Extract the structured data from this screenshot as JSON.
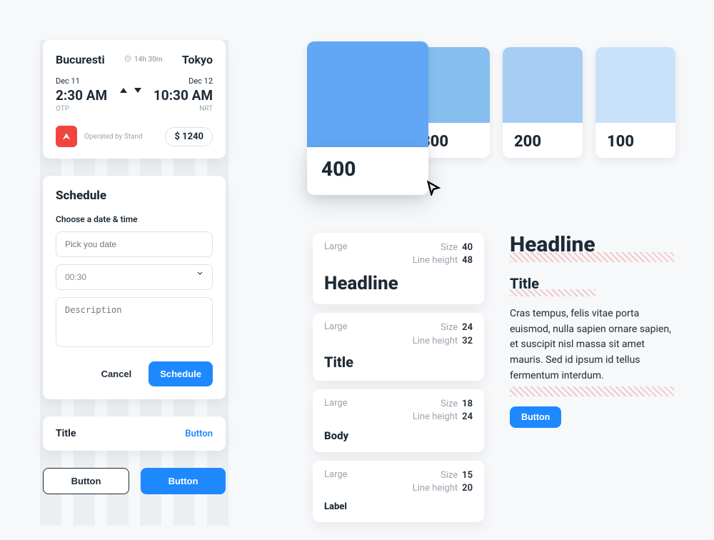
{
  "flight": {
    "from_city": "Bucuresti",
    "to_city": "Tokyo",
    "duration": "14h 30m",
    "dep_date": "Dec 11",
    "dep_time": "2:30 AM",
    "dep_code": "OTP",
    "arr_date": "Dec 12",
    "arr_time": "10:30 AM",
    "arr_code": "NRT",
    "operated_by": "Operated by Stand",
    "price": "$ 1240"
  },
  "schedule": {
    "title": "Schedule",
    "choose_label": "Choose a date & time",
    "date_placeholder": "Pick you date",
    "time_value": "00:30",
    "desc_placeholder": "Description",
    "cancel": "Cancel",
    "submit": "Schedule"
  },
  "tile": {
    "title": "Title",
    "action": "Button"
  },
  "btn_pair": {
    "outline": "Button",
    "primary": "Button"
  },
  "swatches": [
    {
      "label": "400",
      "color": "#62a7f5"
    },
    {
      "label": "300",
      "color": "#86beef"
    },
    {
      "label": "200",
      "color": "#a8cdf5"
    },
    {
      "label": "100",
      "color": "#c9e2fb"
    }
  ],
  "type_specs": [
    {
      "tag": "Large",
      "size": "40",
      "lh": "48",
      "specimen": "Headline",
      "font_px": "26"
    },
    {
      "tag": "Large",
      "size": "24",
      "lh": "32",
      "specimen": "Title",
      "font_px": "20"
    },
    {
      "tag": "Large",
      "size": "18",
      "lh": "24",
      "specimen": "Body",
      "font_px": "15"
    },
    {
      "tag": "Large",
      "size": "15",
      "lh": "20",
      "specimen": "Label",
      "font_px": "13"
    }
  ],
  "type_specs_labels": {
    "size": "Size",
    "lh": "Line height"
  },
  "showcase": {
    "headline": "Headline",
    "title": "Title",
    "body": "Cras tempus, felis vitae porta euismod, nulla sapien ornare sapien, et suscipit nisl massa sit amet mauris. Sed id ipsum id tellus fermentum interdum.",
    "button": "Button"
  }
}
